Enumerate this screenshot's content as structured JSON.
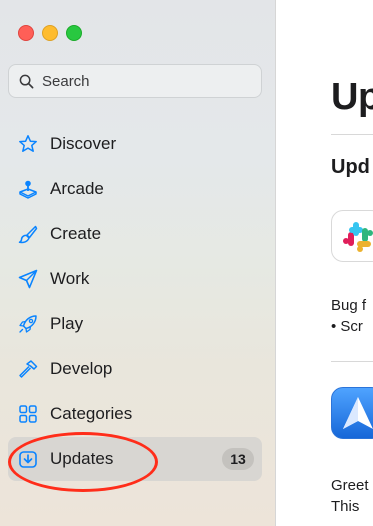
{
  "window": {
    "traffic_lights": [
      "close",
      "minimize",
      "zoom"
    ],
    "colors": {
      "close": "#ff5f57",
      "minimize": "#febc2e",
      "zoom": "#28c840"
    }
  },
  "search": {
    "placeholder": "Search",
    "icon": "magnifying-glass"
  },
  "sidebar": {
    "items": [
      {
        "label": "Discover",
        "icon": "star-icon"
      },
      {
        "label": "Arcade",
        "icon": "joystick-icon"
      },
      {
        "label": "Create",
        "icon": "paintbrush-icon"
      },
      {
        "label": "Work",
        "icon": "paperplane-icon"
      },
      {
        "label": "Play",
        "icon": "rocket-icon"
      },
      {
        "label": "Develop",
        "icon": "hammer-icon"
      },
      {
        "label": "Categories",
        "icon": "grid-icon"
      },
      {
        "label": "Updates",
        "icon": "download-icon",
        "selected": true,
        "badge": "13"
      }
    ],
    "accent_color": "#0a84ff",
    "annotation_color": "#ff2d1a"
  },
  "main": {
    "title": "Up",
    "section": "Upd",
    "apps": [
      {
        "icon": "slack-icon",
        "notes": [
          "Bug f",
          "• Scr"
        ]
      },
      {
        "icon": "spark-icon",
        "notes": [
          "Greet",
          "This"
        ]
      }
    ]
  }
}
